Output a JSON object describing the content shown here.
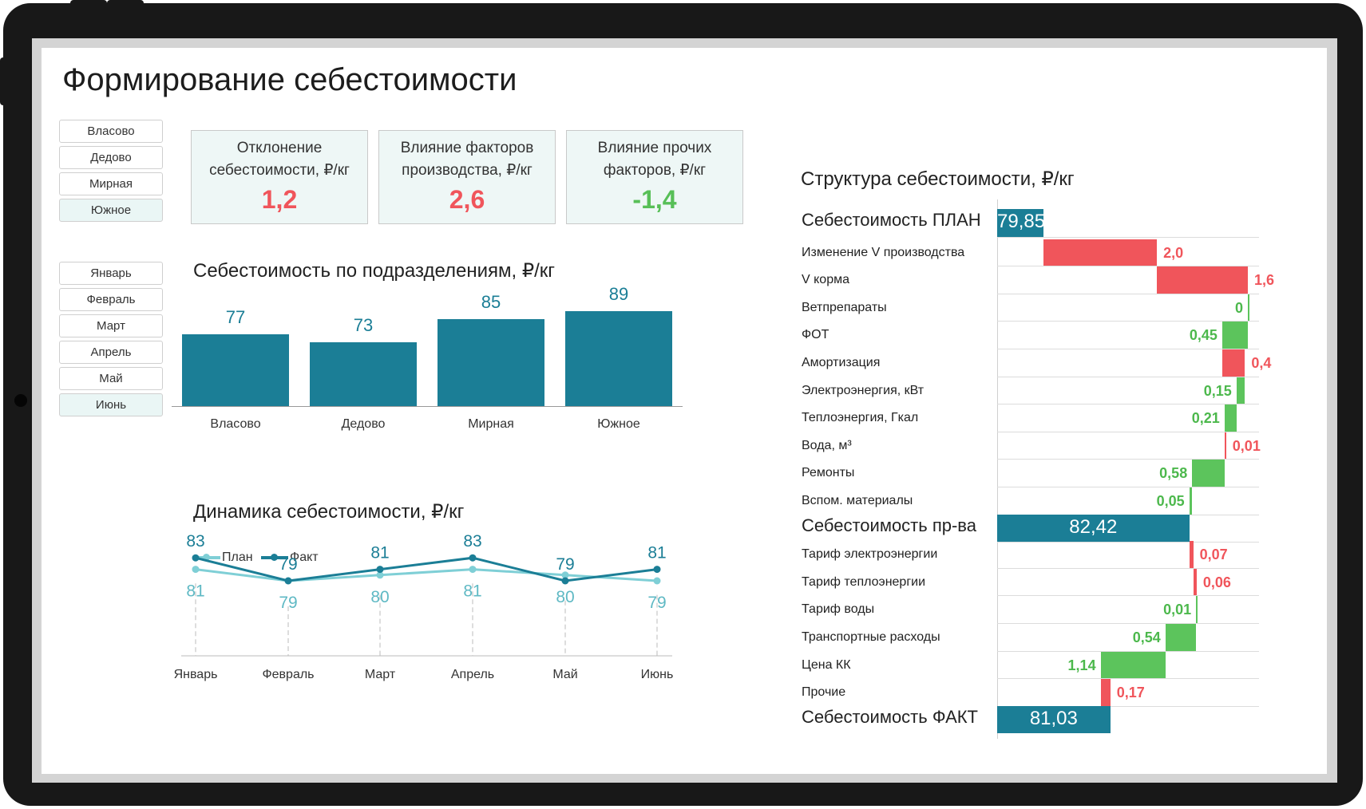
{
  "title": "Формирование себестоимости",
  "slicer_divisions": [
    {
      "label": "Власово",
      "selected": false
    },
    {
      "label": "Дедово",
      "selected": false
    },
    {
      "label": "Мирная",
      "selected": false
    },
    {
      "label": "Южное",
      "selected": true
    }
  ],
  "slicer_months": [
    {
      "label": "Январь",
      "selected": false
    },
    {
      "label": "Февраль",
      "selected": false
    },
    {
      "label": "Март",
      "selected": false
    },
    {
      "label": "Апрель",
      "selected": false
    },
    {
      "label": "Май",
      "selected": false
    },
    {
      "label": "Июнь",
      "selected": true
    }
  ],
  "kpis": [
    {
      "label": "Отклонение себестоимости, ₽/кг",
      "value": "1,2",
      "color": "#f0555b"
    },
    {
      "label": "Влияние факторов производства, ₽/кг",
      "value": "2,6",
      "color": "#f0555b"
    },
    {
      "label": "Влияние прочих факторов, ₽/кг",
      "value": "-1,4",
      "color": "#57bf57"
    }
  ],
  "colors": {
    "teal": "#1b7e96",
    "plan": "#7fcfd6",
    "neg": "#f0555b",
    "pos": "#5cc45c"
  },
  "chart_data": [
    {
      "type": "bar",
      "title": "Себестоимость по подразделениям, ₽/кг",
      "categories": [
        "Власово",
        "Дедово",
        "Мирная",
        "Южное"
      ],
      "values": [
        77,
        73,
        85,
        89
      ]
    },
    {
      "type": "line",
      "title": "Динамика себестоимости, ₽/кг",
      "categories": [
        "Январь",
        "Февраль",
        "Март",
        "Апрель",
        "Май",
        "Июнь"
      ],
      "series": [
        {
          "name": "План",
          "values": [
            81,
            79,
            80,
            81,
            80,
            79
          ]
        },
        {
          "name": "Факт",
          "values": [
            83,
            79,
            81,
            83,
            79,
            81
          ]
        }
      ],
      "legend": "top-left"
    },
    {
      "type": "bar",
      "subtype": "waterfall",
      "title": "Структура себестоимости, ₽/кг",
      "rows": [
        {
          "label": "Себестоимость ПЛАН",
          "kind": "total",
          "value": 79.85,
          "text": "79,85"
        },
        {
          "label": "Изменение V производства",
          "kind": "inc",
          "value": 2.0,
          "text": "2,0"
        },
        {
          "label": "V корма",
          "kind": "inc",
          "value": 1.6,
          "text": "1,6"
        },
        {
          "label": "Ветпрепараты",
          "kind": "dec",
          "value": 0,
          "text": "0"
        },
        {
          "label": "ФОТ",
          "kind": "dec",
          "value": 0.45,
          "text": "0,45"
        },
        {
          "label": "Амортизация",
          "kind": "inc",
          "value": 0.4,
          "text": "0,4"
        },
        {
          "label": "Электроэнергия, кВт",
          "kind": "dec",
          "value": 0.15,
          "text": "0,15"
        },
        {
          "label": "Теплоэнергия, Гкал",
          "kind": "dec",
          "value": 0.21,
          "text": "0,21"
        },
        {
          "label": "Вода, м³",
          "kind": "inc",
          "value": 0.01,
          "text": "0,01"
        },
        {
          "label": "Ремонты",
          "kind": "dec",
          "value": 0.58,
          "text": "0,58"
        },
        {
          "label": "Вспом. материалы",
          "kind": "dec",
          "value": 0.05,
          "text": "0,05"
        },
        {
          "label": "Себестоимость пр-ва",
          "kind": "total",
          "value": 82.42,
          "text": "82,42"
        },
        {
          "label": "Тариф электроэнергии",
          "kind": "inc",
          "value": 0.07,
          "text": "0,07"
        },
        {
          "label": "Тариф теплоэнергии",
          "kind": "inc",
          "value": 0.06,
          "text": "0,06"
        },
        {
          "label": "Тариф воды",
          "kind": "dec",
          "value": 0.01,
          "text": "0,01"
        },
        {
          "label": "Транспортные расходы",
          "kind": "dec",
          "value": 0.54,
          "text": "0,54"
        },
        {
          "label": "Цена КК",
          "kind": "dec",
          "value": 1.14,
          "text": "1,14"
        },
        {
          "label": "Прочие",
          "kind": "inc",
          "value": 0.17,
          "text": "0,17"
        },
        {
          "label": "Себестоимость ФАКТ",
          "kind": "total",
          "value": 81.03,
          "text": "81,03"
        }
      ]
    }
  ]
}
